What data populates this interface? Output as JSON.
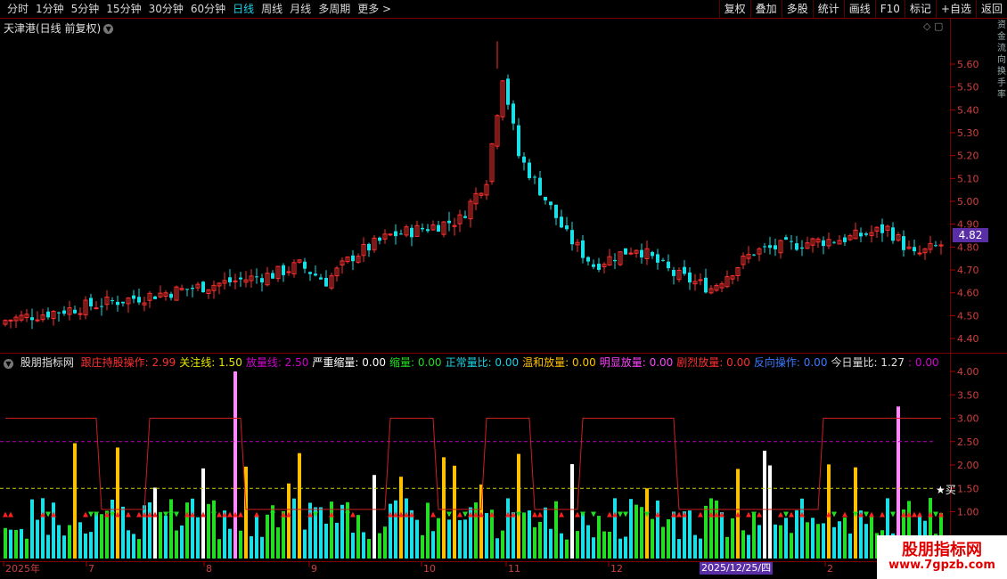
{
  "toolbar": {
    "periods": [
      "分时",
      "1分钟",
      "5分钟",
      "15分钟",
      "30分钟",
      "60分钟",
      "日线",
      "周线",
      "月线",
      "多周期",
      "更多 >"
    ],
    "active_period": "日线",
    "actions": [
      "复权",
      "叠加",
      "多股",
      "统计",
      "画线",
      "F10",
      "标记",
      "+自选",
      "返回"
    ]
  },
  "stock": {
    "title": "天津港(日线 前复权)",
    "last_price": "4.82"
  },
  "price_axis": {
    "labels": [
      "5.60",
      "5.50",
      "5.40",
      "5.30",
      "5.20",
      "5.10",
      "5.00",
      "4.90",
      "4.80",
      "4.70",
      "4.60",
      "4.50",
      "4.40"
    ]
  },
  "indicator": {
    "name": "股朋指标网",
    "items": [
      {
        "label": "跟庄持股操作:",
        "value": "2.99",
        "color": "#ff3030"
      },
      {
        "label": "关注线:",
        "value": "1.50",
        "color": "#e6e600"
      },
      {
        "label": "放量线:",
        "value": "2.50",
        "color": "#d000d0"
      },
      {
        "label": "严重缩量:",
        "value": "0.00",
        "color": "#ffffff"
      },
      {
        "label": "缩量:",
        "value": "0.00",
        "color": "#22dd22"
      },
      {
        "label": "正常量比:",
        "value": "0.00",
        "color": "#19d3e6"
      },
      {
        "label": "温和放量:",
        "value": "0.00",
        "color": "#ffc000"
      },
      {
        "label": "明显放量:",
        "value": "0.00",
        "color": "#ff44ff"
      },
      {
        "label": "剧烈放量:",
        "value": "0.00",
        "color": "#ff3030"
      },
      {
        "label": "反向操作:",
        "value": "0.00",
        "color": "#3a7aff"
      },
      {
        "label": "今日量比:",
        "value": "1.27",
        "color": "#e0e0e0"
      },
      {
        "label": ":",
        "value": "0.00",
        "color": "#d000d0"
      }
    ],
    "axis_labels": [
      "4.00",
      "3.50",
      "3.00",
      "2.50",
      "2.00",
      "1.50",
      "1.00"
    ],
    "buy_marker": "★买"
  },
  "date_axis": {
    "labels": [
      "2025年",
      "7",
      "8",
      "9",
      "10",
      "11",
      "12",
      "2"
    ],
    "cursor_date": "2025/12/25/四"
  },
  "right_strip_text": "资金流向换手率",
  "watermark": {
    "title": "股朋指标网",
    "url": "www.7gpzb.com"
  },
  "colors": {
    "up": "#ff3030",
    "down": "#19e0e6",
    "accent": "#5a2ea6"
  }
}
